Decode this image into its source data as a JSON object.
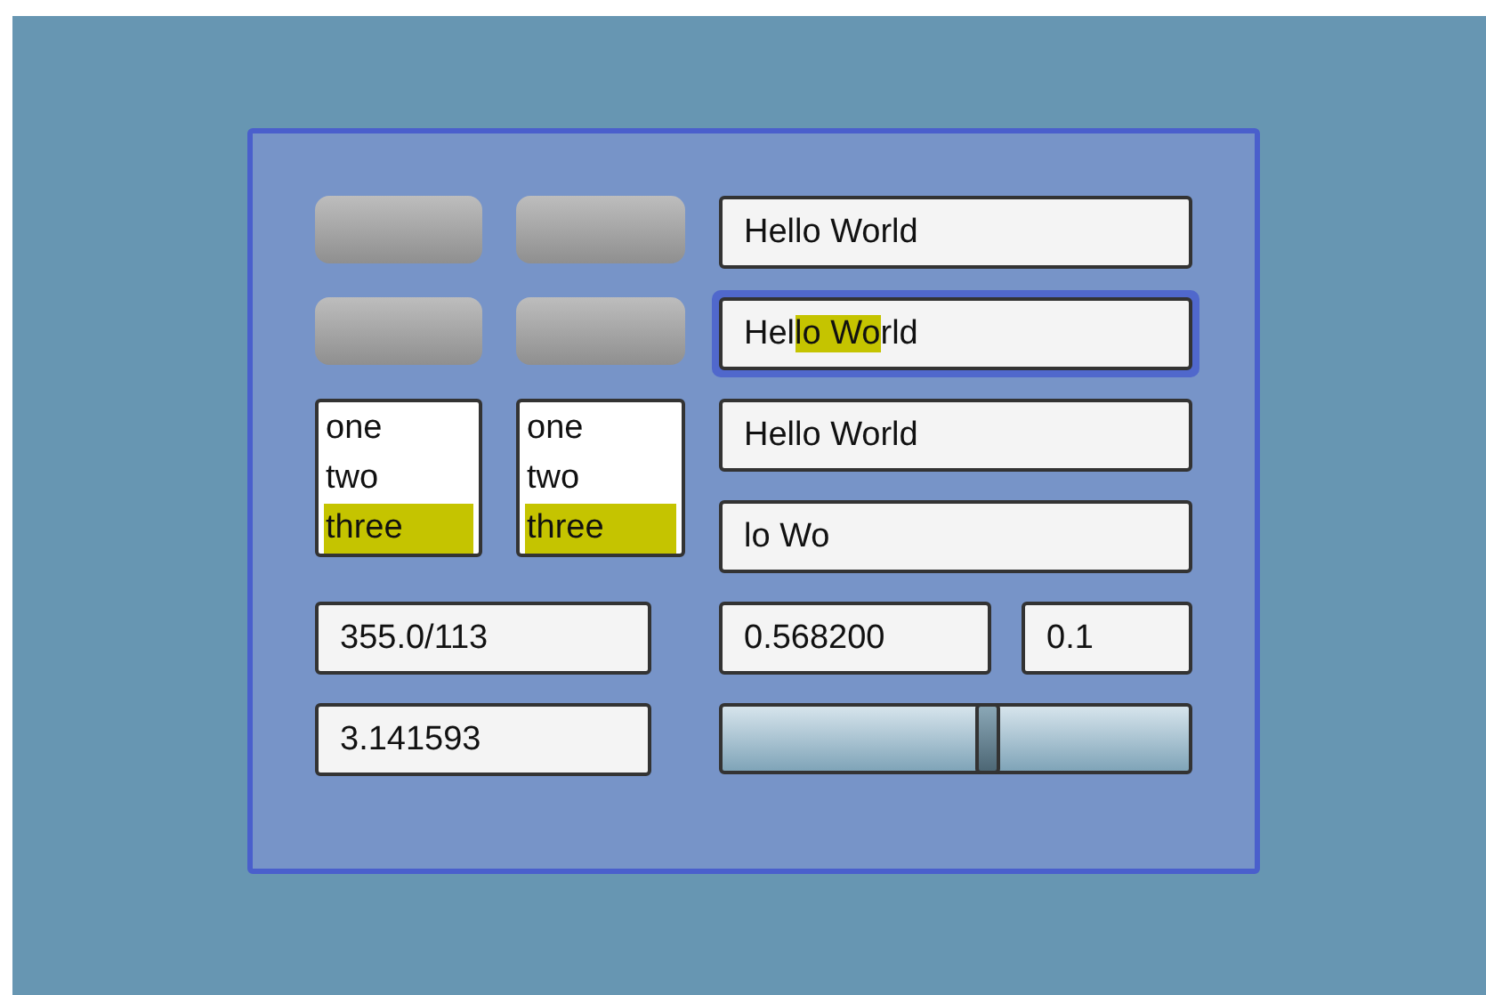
{
  "buttons": [
    {
      "kind": "button"
    },
    {
      "kind": "button"
    },
    {
      "kind": "button"
    },
    {
      "kind": "button"
    }
  ],
  "text_fields": [
    {
      "focused": false,
      "value_parts": [
        {
          "text": "Hello World",
          "highlighted": false
        }
      ]
    },
    {
      "focused": true,
      "value_parts": [
        {
          "text": "Hel",
          "highlighted": false
        },
        {
          "text": "lo Wo",
          "highlighted": true
        },
        {
          "text": "rld",
          "highlighted": false
        }
      ]
    },
    {
      "focused": false,
      "value_parts": [
        {
          "text": "Hello World",
          "highlighted": false
        }
      ]
    },
    {
      "focused": false,
      "value_parts": [
        {
          "text": "lo Wo",
          "highlighted": false
        }
      ]
    }
  ],
  "lists": [
    {
      "items": [
        {
          "label": "one",
          "selected": false
        },
        {
          "label": "two",
          "selected": false
        },
        {
          "label": "three",
          "selected": true
        }
      ]
    },
    {
      "items": [
        {
          "label": "one",
          "selected": false
        },
        {
          "label": "two",
          "selected": false
        },
        {
          "label": "three",
          "selected": true
        }
      ]
    }
  ],
  "number_fields": [
    {
      "value": "355.0/113"
    },
    {
      "value": "3.141593"
    },
    {
      "value": "0.568200"
    },
    {
      "value": "0.1"
    }
  ],
  "slider": {
    "level": 0.568
  }
}
